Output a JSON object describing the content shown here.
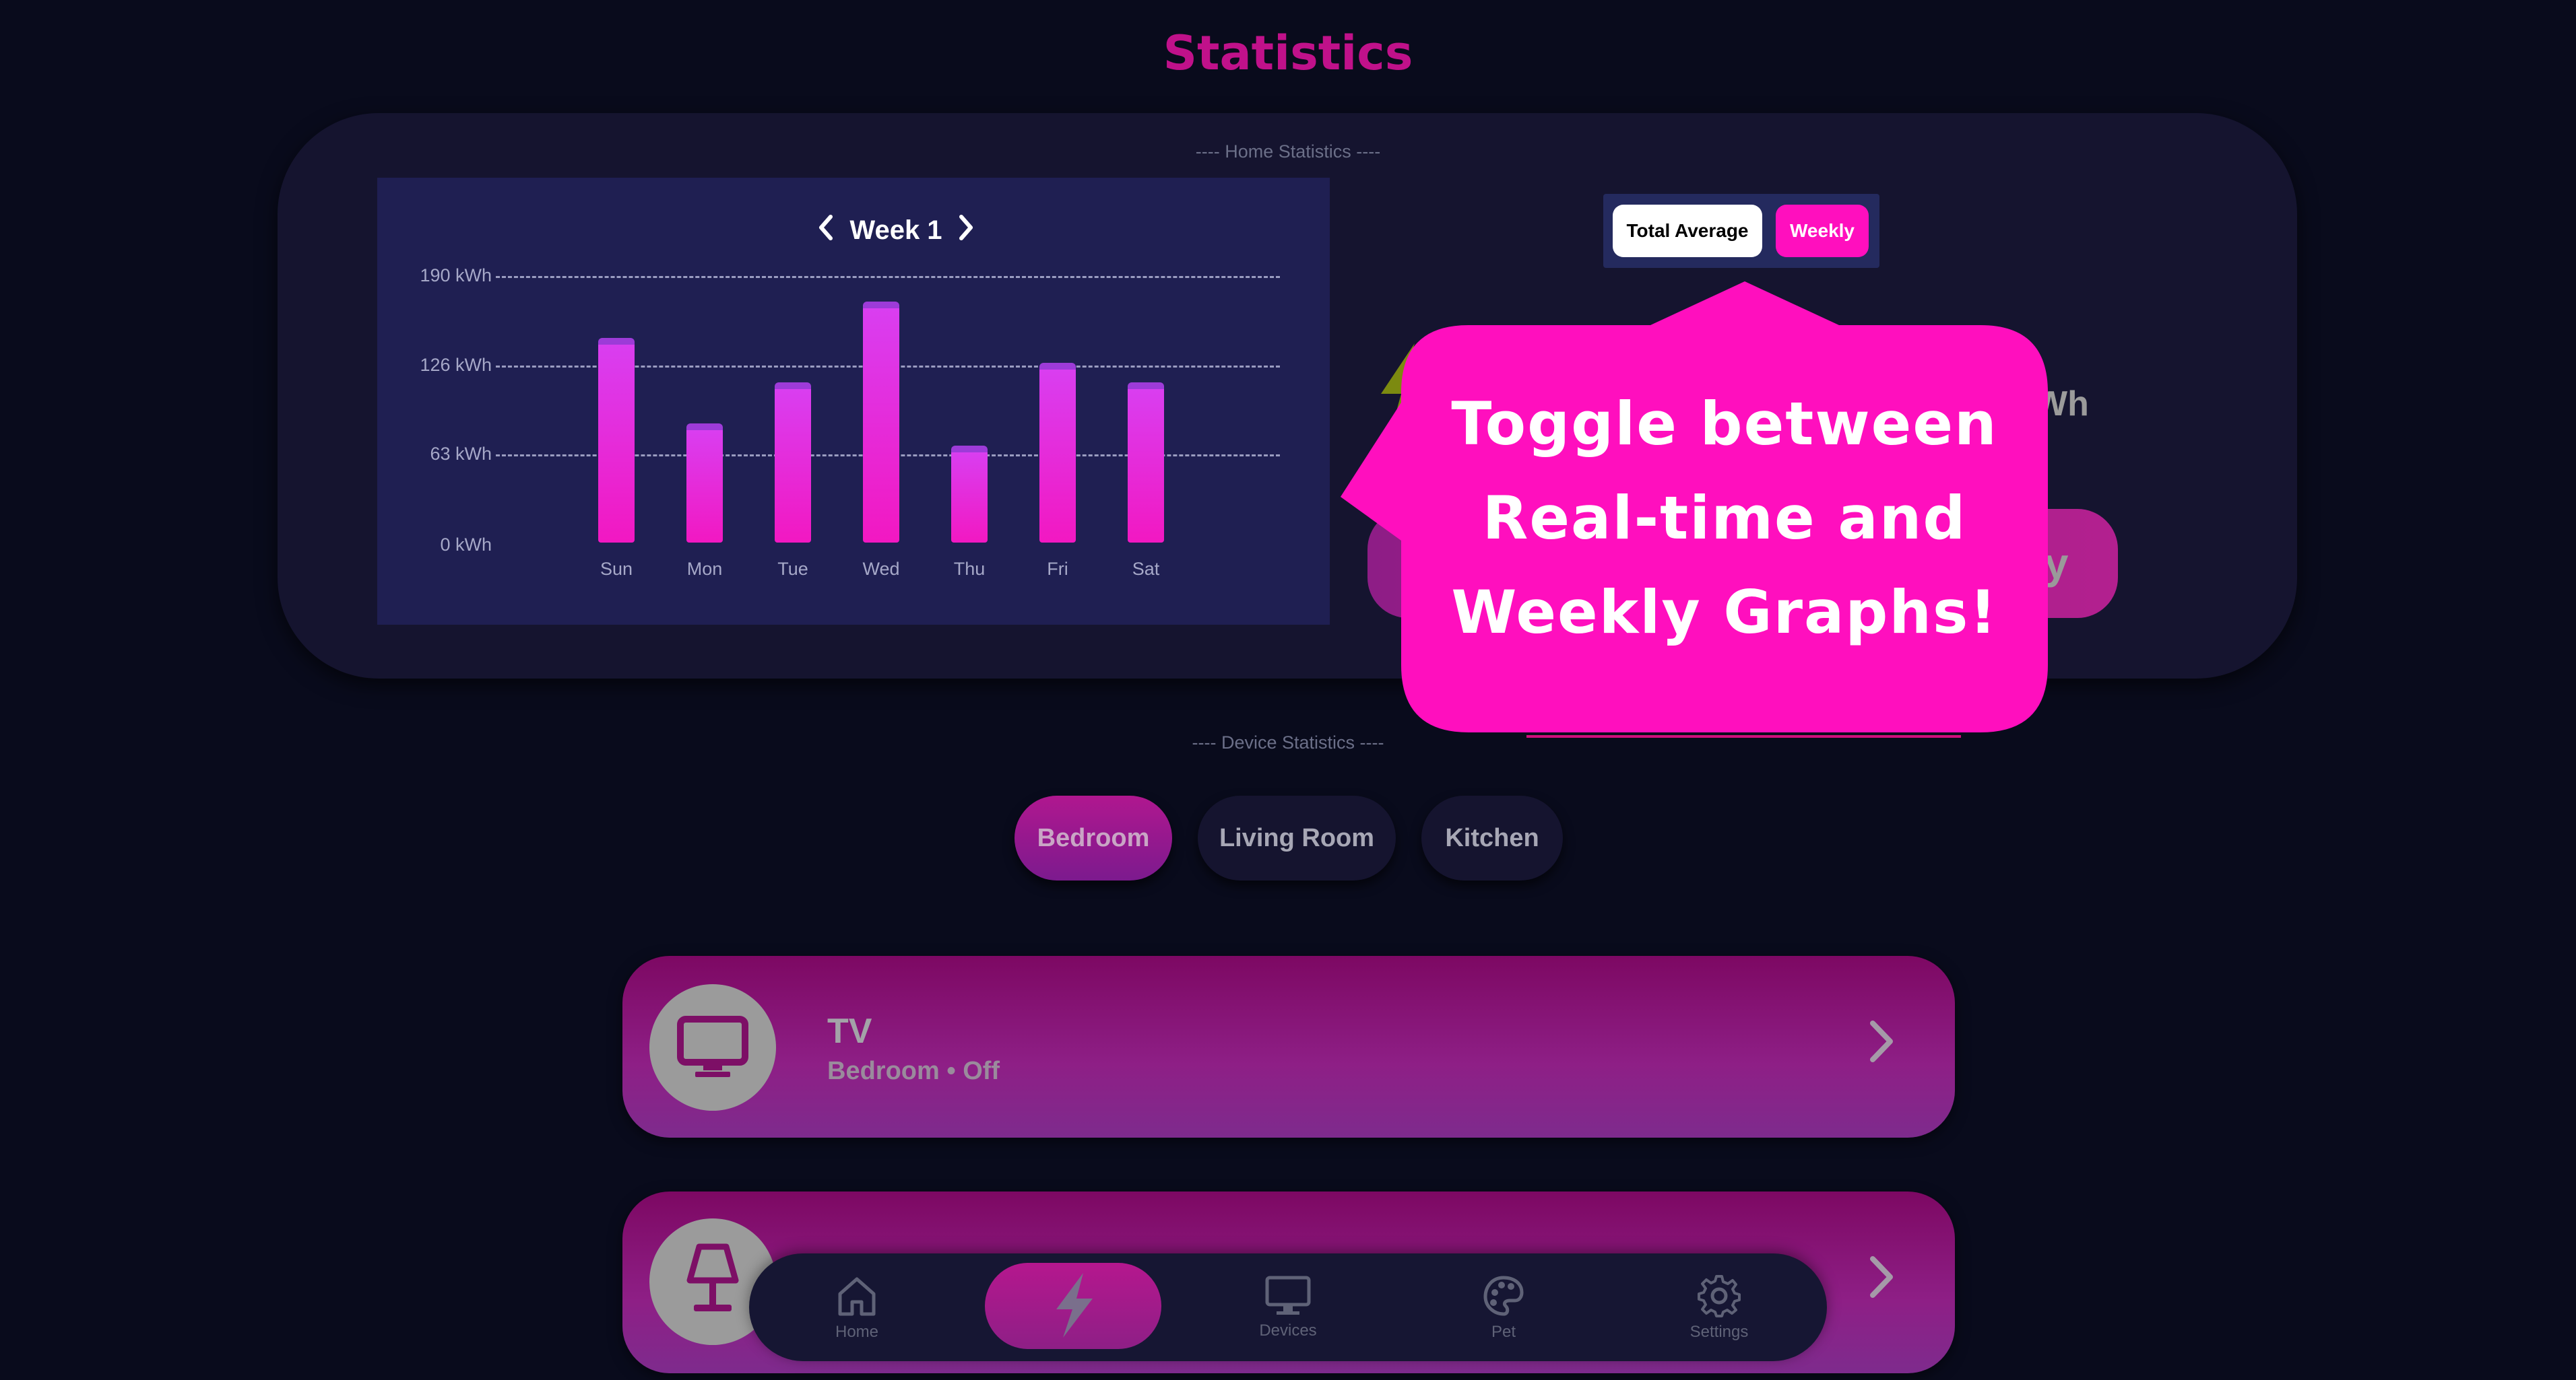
{
  "page": {
    "title": "Statistics"
  },
  "home_statistics": {
    "section_label": "---- Home Statistics ----",
    "week_label": "Week 1",
    "prev_icon": "chevron-left-icon",
    "next_icon": "chevron-right-icon",
    "toggle": {
      "options": [
        "Total Average",
        "Weekly"
      ],
      "selected": "Weekly",
      "accent": "#ff0fbe"
    },
    "partial_kwh_text": "Wh",
    "partial_history_label": "ry"
  },
  "chart_data": {
    "type": "bar",
    "title": "",
    "categories": [
      "Sun",
      "Mon",
      "Tue",
      "Wed",
      "Thu",
      "Fri",
      "Sat"
    ],
    "values": [
      146,
      85,
      114,
      172,
      69,
      128,
      114
    ],
    "ylim": [
      0,
      190
    ],
    "yticks": [
      0,
      63,
      126,
      190
    ],
    "ytick_labels": [
      "0 kWh",
      "63 kWh",
      "126 kWh",
      "190 kWh"
    ],
    "grid": true,
    "bar_color": "#f218c2"
  },
  "tooltip": {
    "lines": [
      "Toggle between",
      "Real-time and",
      "Weekly Graphs!"
    ],
    "color": "#ff0fbe"
  },
  "device_statistics": {
    "section_label": "---- Device Statistics ----",
    "rooms": [
      {
        "label": "Bedroom",
        "active": true
      },
      {
        "label": "Living Room",
        "active": false
      },
      {
        "label": "Kitchen",
        "active": false
      }
    ],
    "devices": [
      {
        "name": "TV",
        "subtitle": "Bedroom • Off",
        "icon": "tv-icon"
      },
      {
        "name": "",
        "subtitle": "",
        "icon": "lamp-icon"
      }
    ]
  },
  "nav": {
    "items": [
      {
        "label": "Home",
        "icon": "home-icon"
      },
      {
        "label": "",
        "icon": "bolt-icon",
        "active": true
      },
      {
        "label": "Devices",
        "icon": "monitor-icon"
      },
      {
        "label": "Pet",
        "icon": "palette-icon"
      },
      {
        "label": "Settings",
        "icon": "gear-icon"
      }
    ]
  }
}
